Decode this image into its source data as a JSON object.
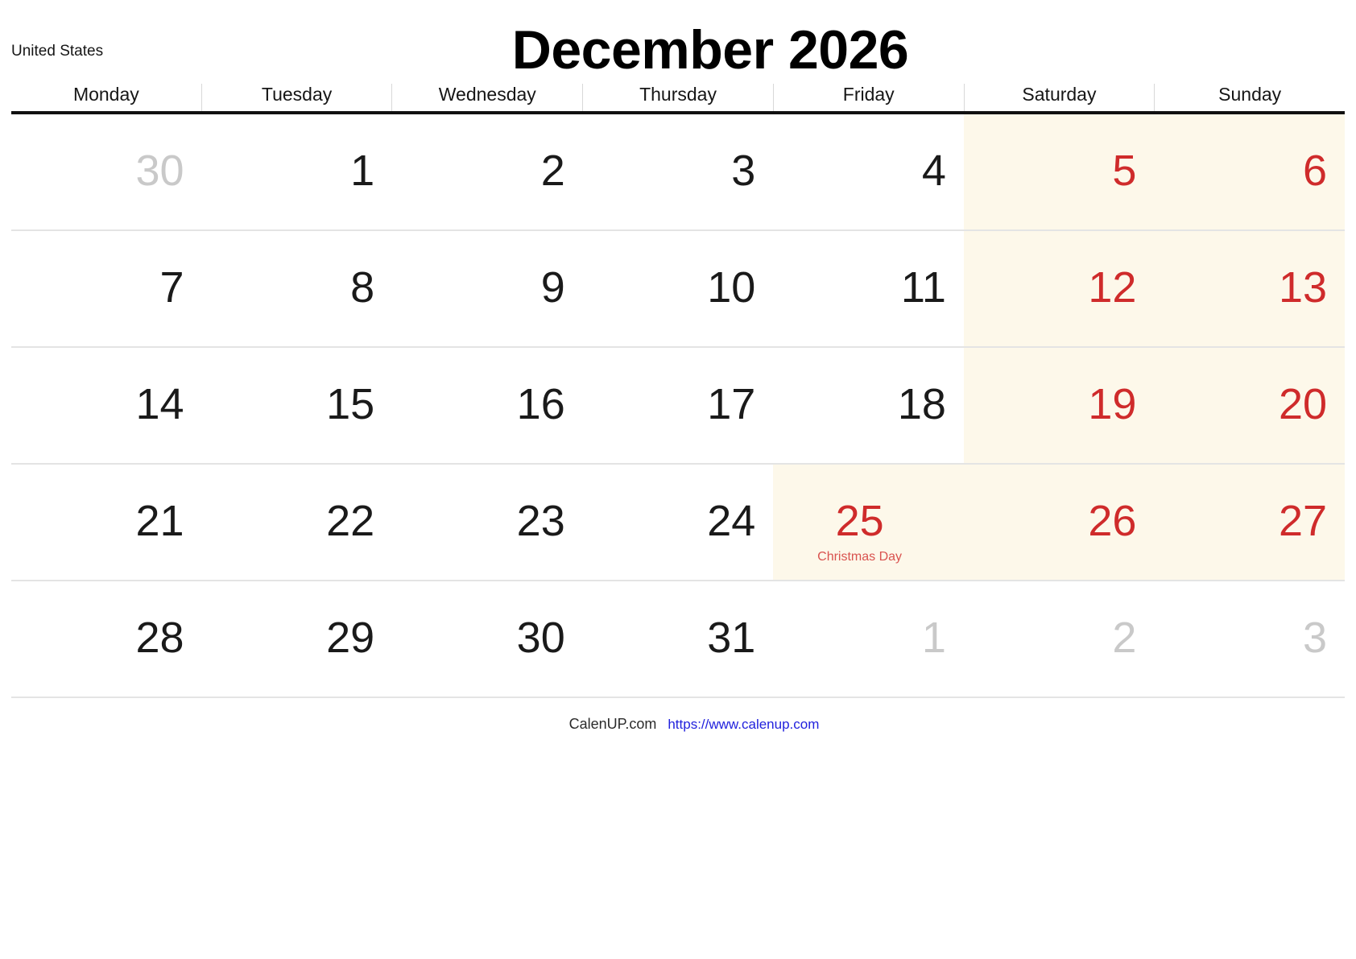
{
  "header": {
    "country": "United States",
    "title": "December 2026"
  },
  "colors": {
    "weekend_bg": "#fdf8ea",
    "weekend_text": "#cf2b2b",
    "muted_text": "#c9c9c9",
    "holiday_text": "#d9534f",
    "link": "#2222dd",
    "header_rule": "#111111",
    "row_rule": "#e4e4e4"
  },
  "weekdays": [
    "Monday",
    "Tuesday",
    "Wednesday",
    "Thursday",
    "Friday",
    "Saturday",
    "Sunday"
  ],
  "weeks": [
    [
      {
        "day": "30",
        "style": "muted",
        "weekend_bg": false,
        "holiday": ""
      },
      {
        "day": "1",
        "style": "normal",
        "weekend_bg": false,
        "holiday": ""
      },
      {
        "day": "2",
        "style": "normal",
        "weekend_bg": false,
        "holiday": ""
      },
      {
        "day": "3",
        "style": "normal",
        "weekend_bg": false,
        "holiday": ""
      },
      {
        "day": "4",
        "style": "normal",
        "weekend_bg": false,
        "holiday": ""
      },
      {
        "day": "5",
        "style": "red",
        "weekend_bg": true,
        "holiday": ""
      },
      {
        "day": "6",
        "style": "red",
        "weekend_bg": true,
        "holiday": ""
      }
    ],
    [
      {
        "day": "7",
        "style": "normal",
        "weekend_bg": false,
        "holiday": ""
      },
      {
        "day": "8",
        "style": "normal",
        "weekend_bg": false,
        "holiday": ""
      },
      {
        "day": "9",
        "style": "normal",
        "weekend_bg": false,
        "holiday": ""
      },
      {
        "day": "10",
        "style": "normal",
        "weekend_bg": false,
        "holiday": ""
      },
      {
        "day": "11",
        "style": "normal",
        "weekend_bg": false,
        "holiday": ""
      },
      {
        "day": "12",
        "style": "red",
        "weekend_bg": true,
        "holiday": ""
      },
      {
        "day": "13",
        "style": "red",
        "weekend_bg": true,
        "holiday": ""
      }
    ],
    [
      {
        "day": "14",
        "style": "normal",
        "weekend_bg": false,
        "holiday": ""
      },
      {
        "day": "15",
        "style": "normal",
        "weekend_bg": false,
        "holiday": ""
      },
      {
        "day": "16",
        "style": "normal",
        "weekend_bg": false,
        "holiday": ""
      },
      {
        "day": "17",
        "style": "normal",
        "weekend_bg": false,
        "holiday": ""
      },
      {
        "day": "18",
        "style": "normal",
        "weekend_bg": false,
        "holiday": ""
      },
      {
        "day": "19",
        "style": "red",
        "weekend_bg": true,
        "holiday": ""
      },
      {
        "day": "20",
        "style": "red",
        "weekend_bg": true,
        "holiday": ""
      }
    ],
    [
      {
        "day": "21",
        "style": "normal",
        "weekend_bg": false,
        "holiday": ""
      },
      {
        "day": "22",
        "style": "normal",
        "weekend_bg": false,
        "holiday": ""
      },
      {
        "day": "23",
        "style": "normal",
        "weekend_bg": false,
        "holiday": ""
      },
      {
        "day": "24",
        "style": "normal",
        "weekend_bg": false,
        "holiday": ""
      },
      {
        "day": "25",
        "style": "red",
        "weekend_bg": true,
        "holiday": "Christmas Day"
      },
      {
        "day": "26",
        "style": "red",
        "weekend_bg": true,
        "holiday": ""
      },
      {
        "day": "27",
        "style": "red",
        "weekend_bg": true,
        "holiday": ""
      }
    ],
    [
      {
        "day": "28",
        "style": "normal",
        "weekend_bg": false,
        "holiday": ""
      },
      {
        "day": "29",
        "style": "normal",
        "weekend_bg": false,
        "holiday": ""
      },
      {
        "day": "30",
        "style": "normal",
        "weekend_bg": false,
        "holiday": ""
      },
      {
        "day": "31",
        "style": "normal",
        "weekend_bg": false,
        "holiday": ""
      },
      {
        "day": "1",
        "style": "muted",
        "weekend_bg": false,
        "holiday": ""
      },
      {
        "day": "2",
        "style": "muted",
        "weekend_bg": false,
        "holiday": ""
      },
      {
        "day": "3",
        "style": "muted",
        "weekend_bg": false,
        "holiday": ""
      }
    ]
  ],
  "footer": {
    "brand": "CalenUP.com",
    "url": "https://www.calenup.com"
  }
}
